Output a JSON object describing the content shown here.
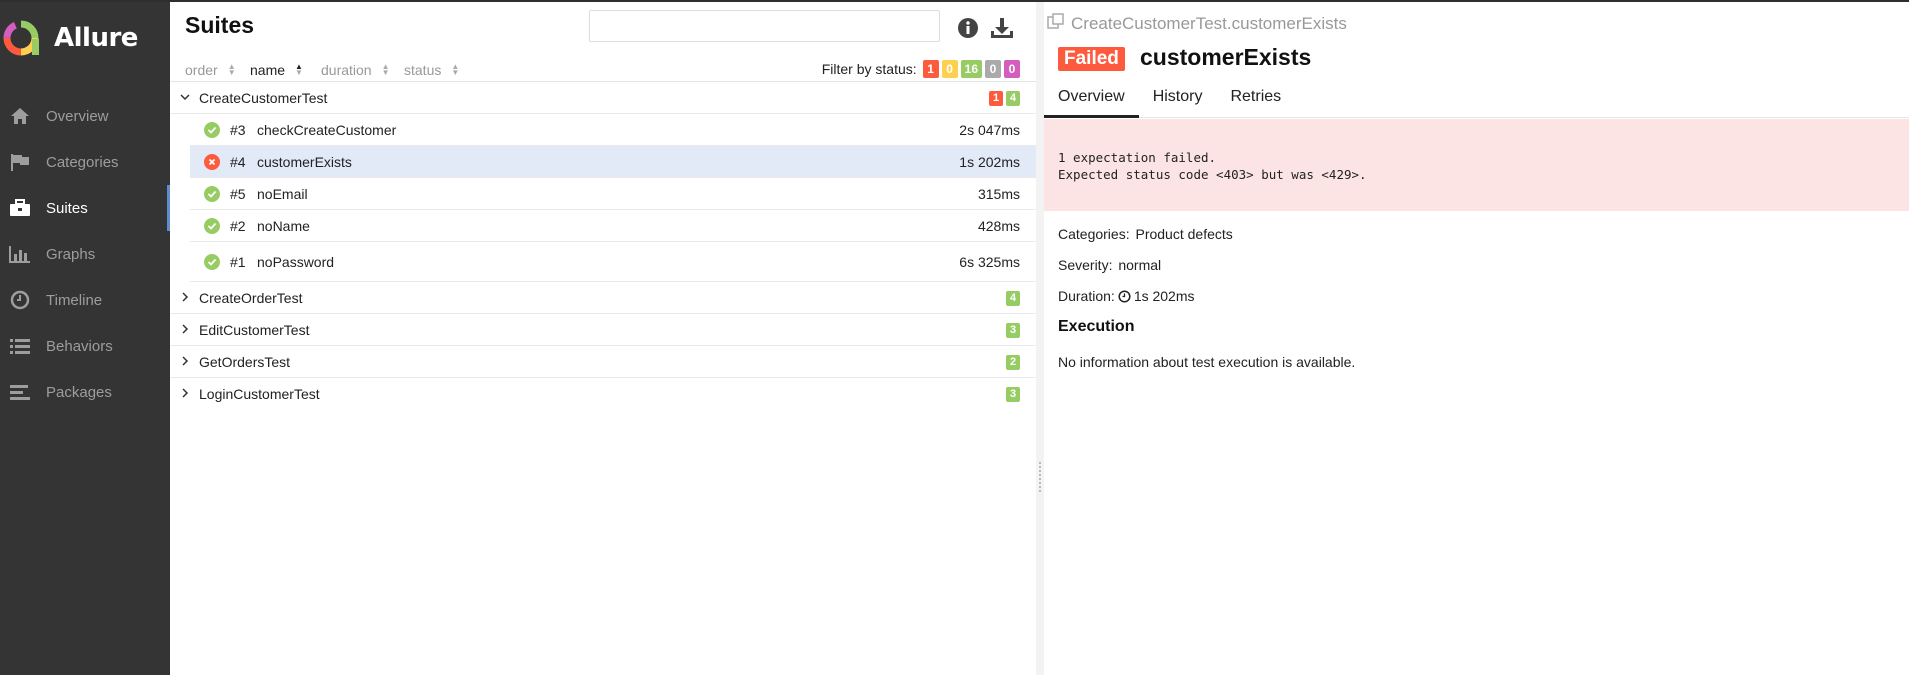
{
  "app": {
    "name": "Allure",
    "colors": {
      "sidebar": "#343434",
      "accent": "#5f8ccf",
      "failed": "#fd5a3e",
      "passed": "#97cc64",
      "broken": "#ffd050",
      "skipped": "#aaaaaa",
      "unknown": "#d35ebe"
    }
  },
  "sidebar": {
    "items": [
      {
        "label": "Overview",
        "icon": "home-icon",
        "active": false
      },
      {
        "label": "Categories",
        "icon": "flag-icon",
        "active": false
      },
      {
        "label": "Suites",
        "icon": "briefcase-icon",
        "active": true
      },
      {
        "label": "Graphs",
        "icon": "bar-chart-icon",
        "active": false
      },
      {
        "label": "Timeline",
        "icon": "clock-icon",
        "active": false
      },
      {
        "label": "Behaviors",
        "icon": "list-icon",
        "active": false
      },
      {
        "label": "Packages",
        "icon": "align-left-icon",
        "active": false
      }
    ]
  },
  "suites": {
    "title": "Suites",
    "search": {
      "placeholder": "",
      "value": ""
    },
    "sort": {
      "order": "order",
      "name": "name",
      "duration": "duration",
      "status": "status"
    },
    "filter": {
      "label": "Filter by status:",
      "failed": "1",
      "broken": "0",
      "passed": "16",
      "skipped": "0",
      "unknown": "0"
    },
    "groups": [
      {
        "name": "CreateCustomerTest",
        "expanded": true,
        "failed": "1",
        "passed": "4",
        "tests": [
          {
            "num": "#3",
            "name": "checkCreateCustomer",
            "duration": "2s 047ms",
            "status": "passed"
          },
          {
            "num": "#4",
            "name": "customerExists",
            "duration": "1s 202ms",
            "status": "failed"
          },
          {
            "num": "#5",
            "name": "noEmail",
            "duration": "315ms",
            "status": "passed"
          },
          {
            "num": "#2",
            "name": "noName",
            "duration": "428ms",
            "status": "passed"
          },
          {
            "num": "#1",
            "name": "noPassword",
            "duration": "6s 325ms",
            "status": "passed"
          }
        ]
      },
      {
        "name": "CreateOrderTest",
        "expanded": false,
        "passed": "4"
      },
      {
        "name": "EditCustomerTest",
        "expanded": false,
        "passed": "3"
      },
      {
        "name": "GetOrdersTest",
        "expanded": false,
        "passed": "2"
      },
      {
        "name": "LoginCustomerTest",
        "expanded": false,
        "passed": "3"
      }
    ]
  },
  "detail": {
    "breadcrumb": "CreateCustomerTest.customerExists",
    "status": "Failed",
    "name": "customerExists",
    "tabs": [
      "Overview",
      "History",
      "Retries"
    ],
    "error": "1 expectation failed.\nExpected status code <403> but was <429>.",
    "categories_label": "Categories:",
    "categories_value": "Product defects",
    "severity_label": "Severity:",
    "severity_value": "normal",
    "duration_label": "Duration:",
    "duration_value": "1s 202ms",
    "execution_title": "Execution",
    "execution_text": "No information about test execution is available."
  }
}
